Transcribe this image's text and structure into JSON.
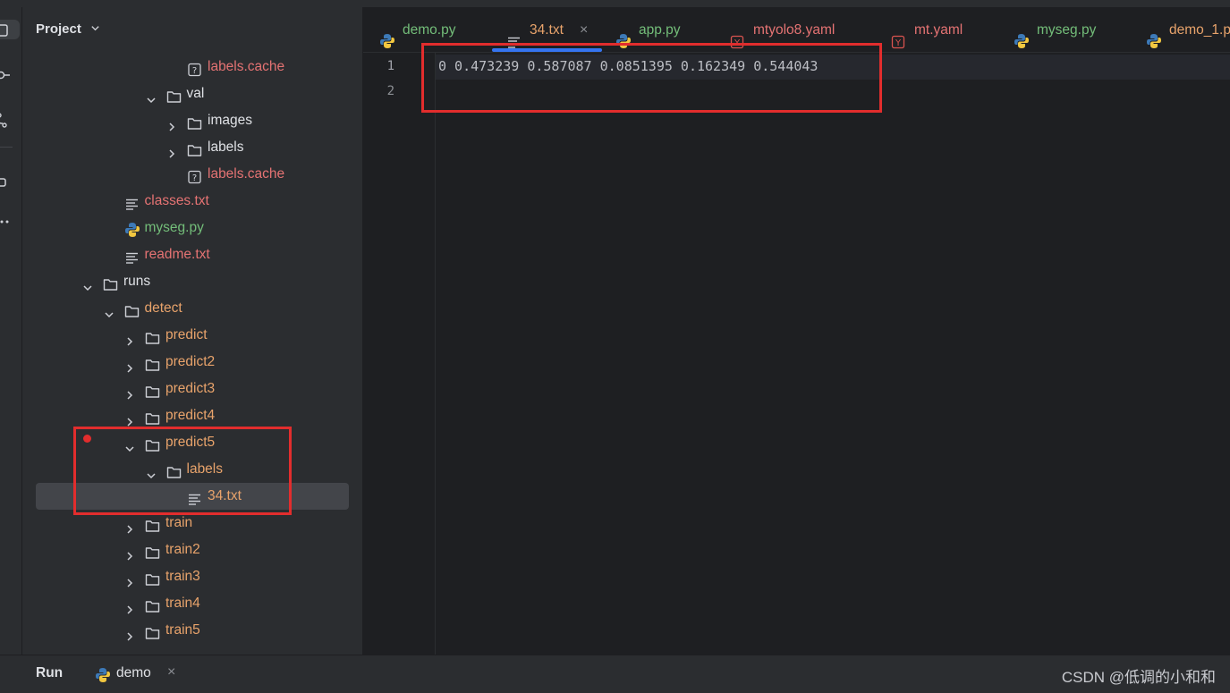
{
  "project_panel": {
    "title": "Project",
    "tree": [
      {
        "label": "labels.cache",
        "icon": "unknown-file-icon",
        "color": "#e57373"
      },
      {
        "label": "val",
        "icon": "folder-icon",
        "expanded": true,
        "color": "#dfe1e5"
      },
      {
        "label": "images",
        "icon": "folder-icon",
        "expanded": false,
        "color": "#dfe1e5"
      },
      {
        "label": "labels",
        "icon": "folder-icon",
        "expanded": false,
        "color": "#dfe1e5"
      },
      {
        "label": "labels.cache",
        "icon": "unknown-file-icon",
        "color": "#e57373"
      },
      {
        "label": "classes.txt",
        "icon": "text-file-icon",
        "color": "#e57373"
      },
      {
        "label": "myseg.py",
        "icon": "python-file-icon",
        "color": "#73bd79"
      },
      {
        "label": "readme.txt",
        "icon": "text-file-icon",
        "color": "#e57373"
      },
      {
        "label": "runs",
        "icon": "folder-icon",
        "expanded": true,
        "color": "#dfe1e5"
      },
      {
        "label": "detect",
        "icon": "folder-icon",
        "expanded": true,
        "color": "#e8a36b"
      },
      {
        "label": "predict",
        "icon": "folder-icon",
        "expanded": false,
        "color": "#e8a36b"
      },
      {
        "label": "predict2",
        "icon": "folder-icon",
        "expanded": false,
        "color": "#e8a36b"
      },
      {
        "label": "predict3",
        "icon": "folder-icon",
        "expanded": false,
        "color": "#e8a36b"
      },
      {
        "label": "predict4",
        "icon": "folder-icon",
        "expanded": false,
        "color": "#e8a36b"
      },
      {
        "label": "predict5",
        "icon": "folder-icon",
        "expanded": true,
        "color": "#e8a36b"
      },
      {
        "label": "labels",
        "icon": "folder-icon",
        "expanded": true,
        "color": "#e8a36b"
      },
      {
        "label": "34.txt",
        "icon": "text-file-icon",
        "selected": true,
        "color": "#e8a36b"
      },
      {
        "label": "train",
        "icon": "folder-icon",
        "expanded": false,
        "color": "#e8a36b"
      },
      {
        "label": "train2",
        "icon": "folder-icon",
        "expanded": false,
        "color": "#e8a36b"
      },
      {
        "label": "train3",
        "icon": "folder-icon",
        "expanded": false,
        "color": "#e8a36b"
      },
      {
        "label": "train4",
        "icon": "folder-icon",
        "expanded": false,
        "color": "#e8a36b"
      },
      {
        "label": "train5",
        "icon": "folder-icon",
        "expanded": false,
        "color": "#e8a36b"
      }
    ]
  },
  "tabs": [
    {
      "label": "demo.py",
      "icon": "python-file-icon",
      "color": "#73bd79"
    },
    {
      "label": "34.txt",
      "icon": "text-file-icon",
      "active": true,
      "color": "#e8a36b",
      "close": "×"
    },
    {
      "label": "app.py",
      "icon": "python-file-icon",
      "color": "#73bd79"
    },
    {
      "label": "mtyolo8.yaml",
      "icon": "yaml-file-icon",
      "color": "#e57373"
    },
    {
      "label": "mt.yaml",
      "icon": "yaml-file-icon",
      "color": "#e57373"
    },
    {
      "label": "myseg.py",
      "icon": "python-file-icon",
      "color": "#73bd79"
    },
    {
      "label": "demo_1.p",
      "icon": "python-file-icon",
      "color": "#e8a36b"
    }
  ],
  "editor": {
    "lines": [
      {
        "number": "1",
        "text": "0 0.473239 0.587087 0.0851395 0.162349 0.544043"
      },
      {
        "number": "2",
        "text": ""
      }
    ]
  },
  "bottom": {
    "run_label": "Run",
    "run_tab": "demo",
    "run_tab_close": "×",
    "watermark": "CSDN @低调的小和和"
  },
  "colors": {
    "accent": "#3574f0",
    "highlight_box": "#e22d2d"
  }
}
